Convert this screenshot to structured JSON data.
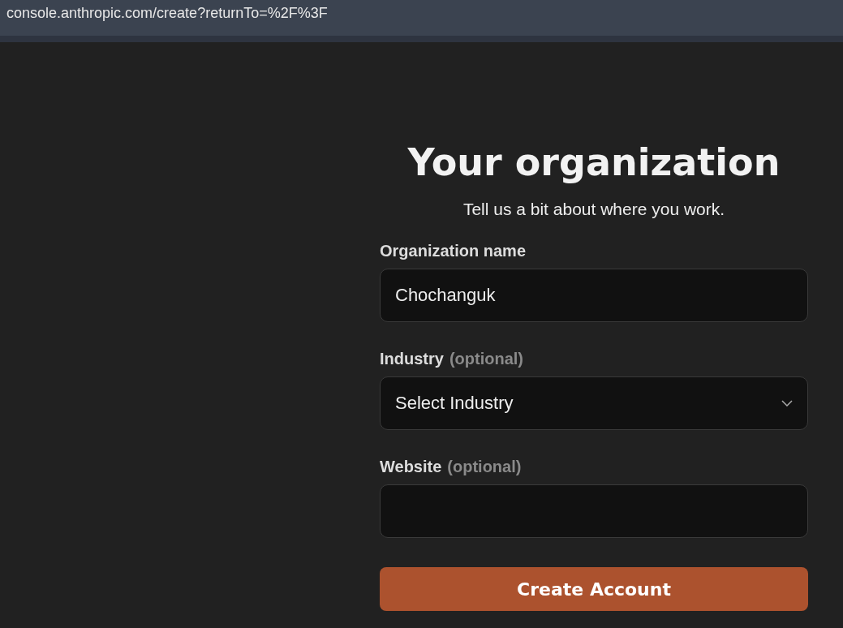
{
  "address_bar": {
    "url": "console.anthropic.com/create?returnTo=%2F%3F"
  },
  "heading": "Your organization",
  "subtitle": "Tell us a bit about where you work.",
  "fields": [
    {
      "kind": "text",
      "label": "Organization name",
      "value": "Chochanguk"
    },
    {
      "kind": "select",
      "label": "Industry",
      "hint": "(optional)",
      "value": "Select Industry"
    },
    {
      "kind": "text",
      "label": "Website",
      "hint": "(optional)"
    }
  ],
  "button": "Create Account"
}
